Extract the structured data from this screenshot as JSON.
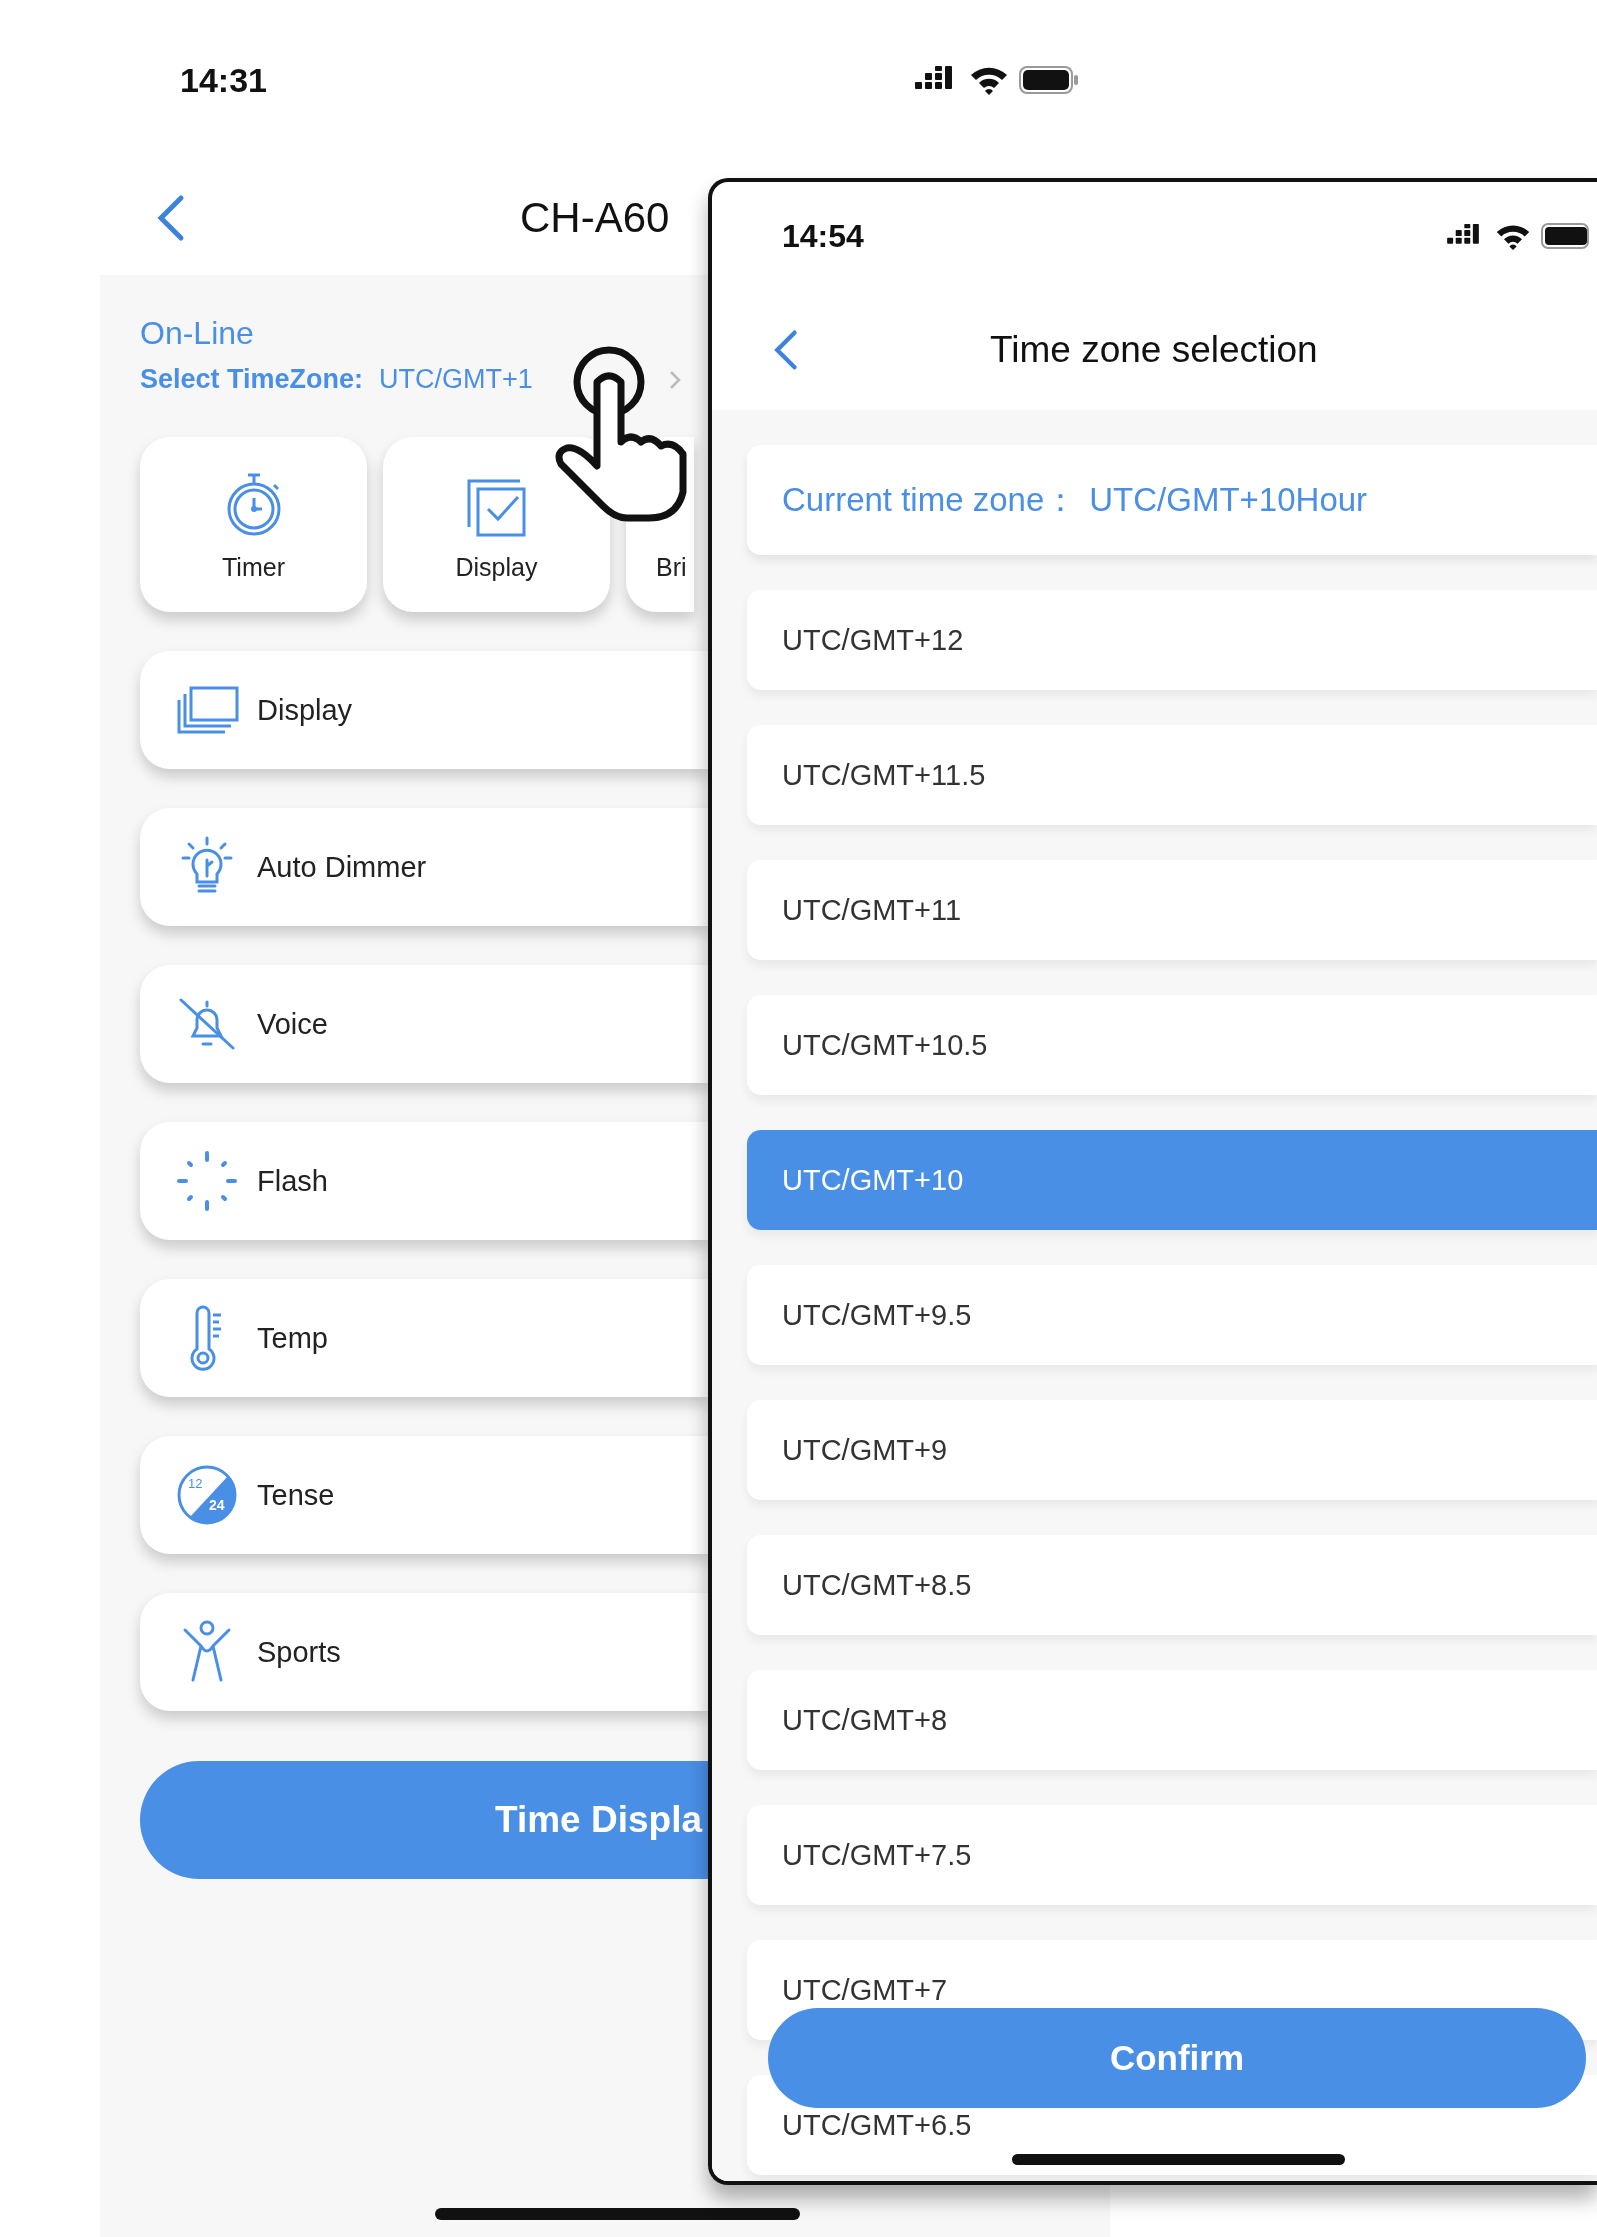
{
  "left_screen": {
    "status_bar": {
      "time": "14:31"
    },
    "title": "CH-A60",
    "status": "On-Line",
    "timezone": {
      "label": "Select TimeZone:",
      "value": "UTC/GMT+1"
    },
    "shortcuts": [
      {
        "label": "Timer",
        "kind": "stopwatch"
      },
      {
        "label": "Display",
        "kind": "checkbox"
      },
      {
        "label": "Bri",
        "kind": "partial"
      }
    ],
    "settings": [
      {
        "label": "Display",
        "kind": "screens"
      },
      {
        "label": "Auto Dimmer",
        "kind": "bulb"
      },
      {
        "label": "Voice",
        "kind": "bell-off"
      },
      {
        "label": "Flash",
        "kind": "dots"
      },
      {
        "label": "Temp",
        "kind": "thermometer"
      },
      {
        "label": "Tense",
        "kind": "clock1224",
        "icon_text": [
          "12",
          "24"
        ]
      },
      {
        "label": "Sports",
        "kind": "person"
      }
    ],
    "button": "Time Displa"
  },
  "right_screen": {
    "status_bar": {
      "time": "14:54"
    },
    "title": "Time zone selection",
    "current": {
      "label": "Current time zone：",
      "value": "UTC/GMT+10Hour"
    },
    "zones": [
      {
        "label": "UTC/GMT+12",
        "selected": false
      },
      {
        "label": "UTC/GMT+11.5",
        "selected": false
      },
      {
        "label": "UTC/GMT+11",
        "selected": false
      },
      {
        "label": "UTC/GMT+10.5",
        "selected": false
      },
      {
        "label": "UTC/GMT+10",
        "selected": true
      },
      {
        "label": "UTC/GMT+9.5",
        "selected": false
      },
      {
        "label": "UTC/GMT+9",
        "selected": false
      },
      {
        "label": "UTC/GMT+8.5",
        "selected": false
      },
      {
        "label": "UTC/GMT+8",
        "selected": false
      },
      {
        "label": "UTC/GMT+7.5",
        "selected": false
      },
      {
        "label": "UTC/GMT+7",
        "selected": false
      },
      {
        "label": "UTC/GMT+6.5",
        "selected": false
      }
    ],
    "confirm": "Confirm"
  }
}
